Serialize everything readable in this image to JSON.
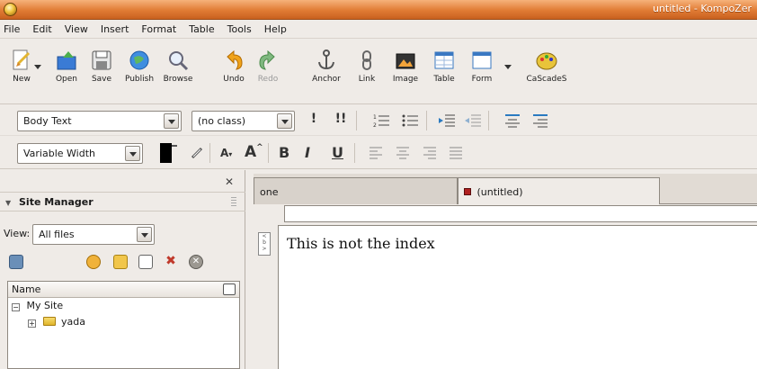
{
  "window": {
    "title": "untitled - KompoZer"
  },
  "menu": [
    "File",
    "Edit",
    "View",
    "Insert",
    "Format",
    "Table",
    "Tools",
    "Help"
  ],
  "toolbar": {
    "new": "New",
    "open": "Open",
    "save": "Save",
    "publish": "Publish",
    "browse": "Browse",
    "undo": "Undo",
    "redo": "Redo",
    "anchor": "Anchor",
    "link": "Link",
    "image": "Image",
    "table": "Table",
    "form": "Form",
    "cascades": "CaScadeS"
  },
  "format1": {
    "paragraph_style": "Body Text",
    "class_select": "(no class)",
    "emphasis": "!",
    "strong": "!!"
  },
  "format2": {
    "font": "Variable Width",
    "bold": "B",
    "italic": "I",
    "underline": "U"
  },
  "side_panel": {
    "title": "Site Manager",
    "view_label": "View:",
    "view_value": "All files",
    "column_name": "Name",
    "tree": [
      {
        "label": "My Site",
        "expander": "−"
      },
      {
        "label": "yada",
        "expander": "+"
      }
    ]
  },
  "editor": {
    "tabs": [
      "one",
      "(untitled)"
    ],
    "content": "This is not the index"
  },
  "colors": {
    "titlebar": "#e07b34",
    "panel_bg": "#efebe7"
  }
}
